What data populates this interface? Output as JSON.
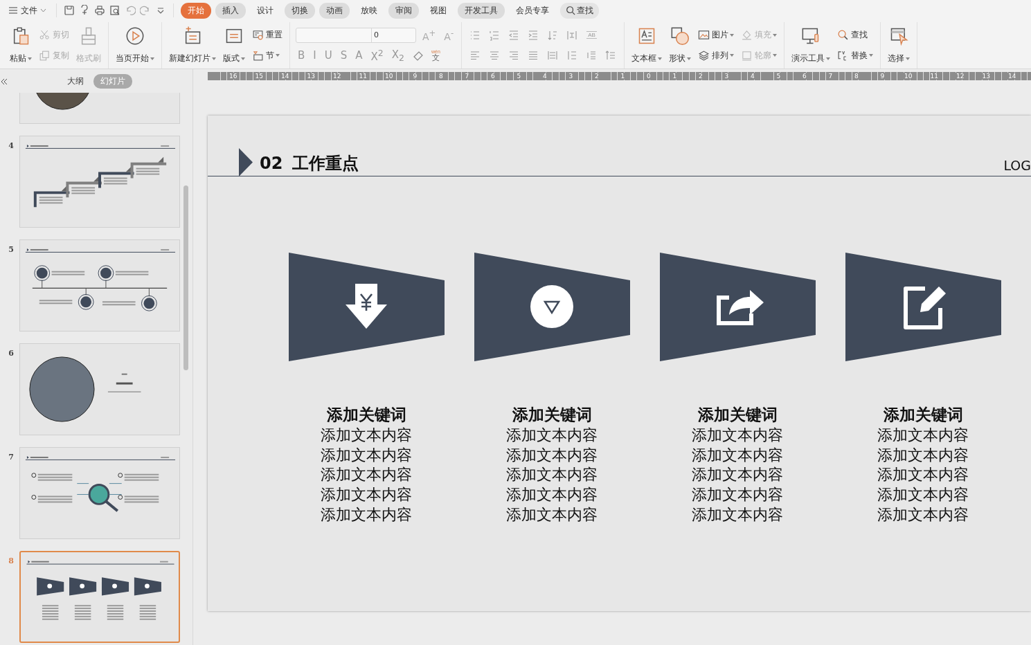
{
  "menu": {
    "file_label": "文件"
  },
  "tabs": [
    {
      "label": "开始",
      "selected": true,
      "shaded": false
    },
    {
      "label": "插入",
      "selected": false,
      "shaded": true
    },
    {
      "label": "设计",
      "selected": false,
      "shaded": false
    },
    {
      "label": "切换",
      "selected": false,
      "shaded": true
    },
    {
      "label": "动画",
      "selected": false,
      "shaded": true
    },
    {
      "label": "放映",
      "selected": false,
      "shaded": false
    },
    {
      "label": "审阅",
      "selected": false,
      "shaded": true
    },
    {
      "label": "视图",
      "selected": false,
      "shaded": false
    },
    {
      "label": "开发工具",
      "selected": false,
      "shaded": true
    },
    {
      "label": "会员专享",
      "selected": false,
      "shaded": false
    }
  ],
  "search": {
    "label": "查找"
  },
  "ribbon": [
    {
      "kind": "buttons",
      "columns": [
        {
          "kind": "large",
          "label": "粘贴",
          "dropdown": true,
          "disabled": false
        },
        {
          "kind": "stack",
          "items": [
            {
              "label": "剪切",
              "dropdown": false,
              "disabled": true
            },
            {
              "label": "复制",
              "dropdown": false,
              "disabled": true
            }
          ]
        },
        {
          "kind": "large",
          "label": "格式刷",
          "dropdown": false,
          "disabled": true
        }
      ]
    },
    {
      "kind": "buttons",
      "columns": [
        {
          "kind": "large",
          "label": "当页开始",
          "dropdown": true,
          "disabled": false
        }
      ]
    },
    {
      "kind": "buttons",
      "columns": [
        {
          "kind": "large",
          "label": "新建幻灯片",
          "dropdown": true,
          "disabled": false
        },
        {
          "kind": "large",
          "label": "版式",
          "dropdown": true,
          "disabled": false
        },
        {
          "kind": "stack",
          "items": [
            {
              "label": "重置",
              "dropdown": false,
              "disabled": false
            },
            {
              "label": "节",
              "dropdown": true,
              "disabled": false
            }
          ]
        }
      ]
    },
    {
      "kind": "font",
      "font_size": "0",
      "size_buttons": [
        "A$^{+}$",
        "A$^{-}$"
      ],
      "formats": [
        "B",
        "I",
        "U",
        "S",
        "A",
        "X$^{2}$",
        "X$_{2}$"
      ],
      "phonetic": {
        "ruby": "wén",
        "base": "文"
      }
    },
    {
      "kind": "paragraph",
      "direction_label": "AB"
    },
    {
      "kind": "buttons",
      "columns": [
        {
          "kind": "large",
          "label": "文本框",
          "dropdown": true,
          "disabled": false
        },
        {
          "kind": "large",
          "label": "形状",
          "dropdown": true,
          "disabled": false
        },
        {
          "kind": "stack",
          "items": [
            {
              "label": "图片",
              "dropdown": true,
              "disabled": false
            },
            {
              "label": "排列",
              "dropdown": true,
              "disabled": false
            }
          ]
        },
        {
          "kind": "stack",
          "items": [
            {
              "label": "填充",
              "dropdown": true,
              "disabled": true
            },
            {
              "label": "轮廓",
              "dropdown": true,
              "disabled": true
            }
          ]
        }
      ]
    },
    {
      "kind": "buttons",
      "columns": [
        {
          "kind": "large",
          "label": "演示工具",
          "dropdown": true,
          "disabled": false
        },
        {
          "kind": "stack",
          "items": [
            {
              "label": "查找",
              "dropdown": false,
              "disabled": false
            },
            {
              "label": "替换",
              "dropdown": true,
              "disabled": false
            }
          ]
        }
      ]
    },
    {
      "kind": "buttons",
      "columns": [
        {
          "kind": "large",
          "label": "选择",
          "dropdown": true,
          "disabled": false
        }
      ]
    }
  ],
  "panel": {
    "tabs": [
      {
        "label": "大纲",
        "selected": false
      },
      {
        "label": "幻灯片",
        "selected": true
      }
    ],
    "slides": [
      {
        "kind": "photo",
        "selected": false
      },
      {
        "number": "4",
        "kind": "steps",
        "selected": false
      },
      {
        "number": "5",
        "kind": "timeline",
        "selected": false
      },
      {
        "number": "6",
        "kind": "section",
        "selected": false
      },
      {
        "number": "7",
        "kind": "magnifier",
        "selected": false
      },
      {
        "number": "8",
        "kind": "cards",
        "selected": true
      }
    ]
  },
  "ruler": [
    "16",
    "15",
    "14",
    "13",
    "12",
    "11",
    "10",
    "9",
    "8",
    "7",
    "6",
    "5",
    "4",
    "3",
    "2",
    "1",
    "0",
    "1",
    "2",
    "3",
    "4",
    "5",
    "6",
    "7",
    "8",
    "9",
    "10",
    "11",
    "12",
    "13",
    "14"
  ],
  "slide": {
    "number": "02",
    "title": "工作重点",
    "logo": "LOG",
    "cards": [
      {
        "keyword": "添加关键词",
        "lines": [
          "添加文本内容",
          "添加文本内容",
          "添加文本内容",
          "添加文本内容",
          "添加文本内容"
        ]
      },
      {
        "keyword": "添加关键词",
        "lines": [
          "添加文本内容",
          "添加文本内容",
          "添加文本内容",
          "添加文本内容",
          "添加文本内容"
        ]
      },
      {
        "keyword": "添加关键词",
        "lines": [
          "添加文本内容",
          "添加文本内容",
          "添加文本内容",
          "添加文本内容",
          "添加文本内容"
        ]
      },
      {
        "keyword": "添加关键词",
        "lines": [
          "添加文本内容",
          "添加文本内容",
          "添加文本内容",
          "添加文本内容",
          "添加文本内容"
        ]
      }
    ]
  }
}
